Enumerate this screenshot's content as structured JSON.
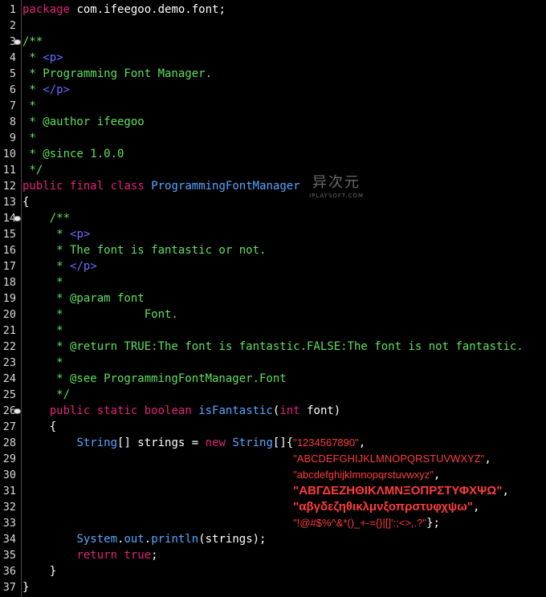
{
  "gutter": {
    "line_numbers": [
      "1",
      "2",
      "3",
      "4",
      "5",
      "6",
      "7",
      "8",
      "9",
      "10",
      "11",
      "12",
      "13",
      "14",
      "15",
      "16",
      "17",
      "18",
      "19",
      "20",
      "21",
      "22",
      "23",
      "24",
      "25",
      "26",
      "27",
      "28",
      "29",
      "30",
      "31",
      "32",
      "33",
      "34",
      "35",
      "36",
      "37"
    ]
  },
  "lines": [
    [
      {
        "t": "package",
        "c": "kw"
      },
      {
        "t": " com.ifeegoo.demo.font;",
        "c": "pl"
      }
    ],
    [],
    [
      {
        "t": "/**",
        "c": "cm"
      }
    ],
    [
      {
        "t": " * ",
        "c": "cm"
      },
      {
        "t": "<p>",
        "c": "tag"
      }
    ],
    [
      {
        "t": " * Programming Font Manager.",
        "c": "cm"
      }
    ],
    [
      {
        "t": " * ",
        "c": "cm"
      },
      {
        "t": "</p>",
        "c": "tag"
      }
    ],
    [
      {
        "t": " *",
        "c": "cm"
      }
    ],
    [
      {
        "t": " * @author ifeegoo",
        "c": "cm"
      }
    ],
    [
      {
        "t": " *",
        "c": "cm"
      }
    ],
    [
      {
        "t": " * @since 1.0.0",
        "c": "cm"
      }
    ],
    [
      {
        "t": " */",
        "c": "cm"
      }
    ],
    [
      {
        "t": "public",
        "c": "kw"
      },
      {
        "t": " ",
        "c": "pl"
      },
      {
        "t": "final",
        "c": "kw"
      },
      {
        "t": " ",
        "c": "pl"
      },
      {
        "t": "class",
        "c": "kw"
      },
      {
        "t": " ",
        "c": "pl"
      },
      {
        "t": "ProgrammingFontManager",
        "c": "ty"
      }
    ],
    [
      {
        "t": "{",
        "c": "pl"
      }
    ],
    [
      {
        "t": "    /**",
        "c": "cm"
      }
    ],
    [
      {
        "t": "     * ",
        "c": "cm"
      },
      {
        "t": "<p>",
        "c": "tag"
      }
    ],
    [
      {
        "t": "     * The font is fantastic or not.",
        "c": "cm"
      }
    ],
    [
      {
        "t": "     * ",
        "c": "cm"
      },
      {
        "t": "</p>",
        "c": "tag"
      }
    ],
    [
      {
        "t": "     *",
        "c": "cm"
      }
    ],
    [
      {
        "t": "     * @param font",
        "c": "cm"
      }
    ],
    [
      {
        "t": "     *            Font.",
        "c": "cm"
      }
    ],
    [
      {
        "t": "     *",
        "c": "cm"
      }
    ],
    [
      {
        "t": "     * @return TRUE:The font is fantastic.FALSE:The font is not fantastic.",
        "c": "cm"
      }
    ],
    [
      {
        "t": "     *",
        "c": "cm"
      }
    ],
    [
      {
        "t": "     * @see ProgrammingFontManager.Font",
        "c": "cm"
      }
    ],
    [
      {
        "t": "     */",
        "c": "cm"
      }
    ],
    [
      {
        "t": "    ",
        "c": "pl"
      },
      {
        "t": "public",
        "c": "kw"
      },
      {
        "t": " ",
        "c": "pl"
      },
      {
        "t": "static",
        "c": "kw"
      },
      {
        "t": " ",
        "c": "pl"
      },
      {
        "t": "boolean",
        "c": "kw"
      },
      {
        "t": " ",
        "c": "pl"
      },
      {
        "t": "isFantastic",
        "c": "fn"
      },
      {
        "t": "(",
        "c": "pl"
      },
      {
        "t": "int",
        "c": "kw"
      },
      {
        "t": " font)",
        "c": "pl"
      }
    ],
    [
      {
        "t": "    {",
        "c": "pl"
      }
    ],
    [
      {
        "t": "        ",
        "c": "pl"
      },
      {
        "t": "String",
        "c": "ty"
      },
      {
        "t": "[] strings = ",
        "c": "pl"
      },
      {
        "t": "new",
        "c": "kw"
      },
      {
        "t": " ",
        "c": "pl"
      },
      {
        "t": "String",
        "c": "ty"
      },
      {
        "t": "[]{",
        "c": "pl"
      },
      {
        "t": "\"1234567890\"",
        "c": "str"
      },
      {
        "t": ",",
        "c": "pl"
      }
    ],
    [
      {
        "t": "                                        ",
        "c": "pl"
      },
      {
        "t": "\"ABCDEFGHIJKLMNOPQRSTUVWXYZ\"",
        "c": "str"
      },
      {
        "t": ",",
        "c": "pl"
      }
    ],
    [
      {
        "t": "                                        ",
        "c": "pl"
      },
      {
        "t": "\"abcdefghijklmnopqrstuvwxyz\"",
        "c": "str"
      },
      {
        "t": ",",
        "c": "pl"
      }
    ],
    [
      {
        "t": "                                        ",
        "c": "pl"
      },
      {
        "t": "\"ΑΒΓΔΕΖΗΘΙΚΛΜΝΞΟΠΡΣΤΥΦΧΨΩ\"",
        "c": "strb"
      },
      {
        "t": ",",
        "c": "pl"
      }
    ],
    [
      {
        "t": "                                        ",
        "c": "pl"
      },
      {
        "t": "\"αβγδεζηθικλμνξοπρστυφχψω\"",
        "c": "strb"
      },
      {
        "t": ",",
        "c": "pl"
      }
    ],
    [
      {
        "t": "                                        ",
        "c": "pl"
      },
      {
        "t": "\"!@#$%^&*()_+-={}|[]':;<>,.?\"",
        "c": "str"
      },
      {
        "t": "};",
        "c": "pl"
      }
    ],
    [
      {
        "t": "        ",
        "c": "pl"
      },
      {
        "t": "System",
        "c": "ty"
      },
      {
        "t": ".",
        "c": "pl"
      },
      {
        "t": "out",
        "c": "ty"
      },
      {
        "t": ".",
        "c": "pl"
      },
      {
        "t": "println",
        "c": "fn"
      },
      {
        "t": "(strings);",
        "c": "pl"
      }
    ],
    [
      {
        "t": "        ",
        "c": "pl"
      },
      {
        "t": "return",
        "c": "kw"
      },
      {
        "t": " ",
        "c": "pl"
      },
      {
        "t": "true",
        "c": "kw"
      },
      {
        "t": ";",
        "c": "pl"
      }
    ],
    [
      {
        "t": "    }",
        "c": "pl"
      }
    ],
    [
      {
        "t": "}",
        "c": "pl"
      }
    ]
  ],
  "fold_markers": [
    "3",
    "14",
    "26"
  ],
  "watermark": {
    "title": "异次元",
    "subtitle": "IPLAYSOFT.COM"
  },
  "colors": {
    "background": "#000000",
    "keyword": "#e0237a",
    "comment": "#5fe05f",
    "html_tag": "#6b6bff",
    "type": "#58a6ff",
    "string": "#ff3b3b",
    "plain": "#ffffff"
  }
}
